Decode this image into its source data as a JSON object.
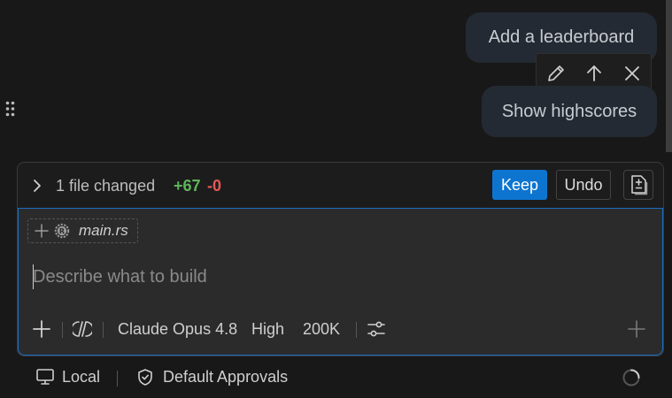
{
  "chat": {
    "messages": [
      {
        "text": "Add a leaderboard"
      },
      {
        "text": "Show highscores"
      }
    ],
    "message_actions": [
      "pencil-icon",
      "arrow-up-icon",
      "close-icon"
    ]
  },
  "changes": {
    "summary": "1 file changed",
    "added": "+67",
    "removed": "-0",
    "keep_label": "Keep",
    "undo_label": "Undo"
  },
  "input": {
    "attached_file": "main.rs",
    "placeholder": "Describe what to build"
  },
  "toolbar": {
    "model": "Claude Opus 4.8",
    "effort": "High",
    "context": "200K"
  },
  "footer": {
    "location": "Local",
    "approvals": "Default Approvals"
  },
  "colors": {
    "accent": "#0d75d0",
    "added": "#5fb55a",
    "removed": "#e55858",
    "bubble": "#242a33",
    "background": "#181818"
  }
}
